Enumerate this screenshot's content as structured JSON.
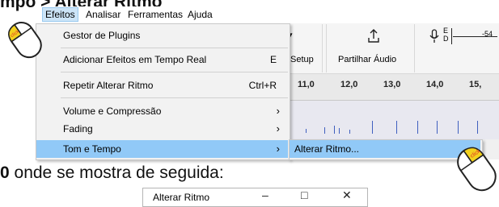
{
  "tutorial": {
    "heading": "mpo > Alterar Ritmo",
    "caption_bold": "0",
    "caption_text": " onde se mostra de seguida:"
  },
  "menubar": {
    "items": [
      "Efeitos",
      "Analisar",
      "Ferramentas",
      "Ajuda"
    ],
    "active_index": 0
  },
  "effects_menu": {
    "items": [
      {
        "label": "Gestor de Plugins",
        "shortcut": "",
        "submenu": false
      },
      {
        "label": "Adicionar Efeitos em Tempo Real",
        "shortcut": "E",
        "submenu": false
      },
      {
        "label": "Repetir Alterar Ritmo",
        "shortcut": "Ctrl+R",
        "submenu": false
      },
      {
        "label": "Volume e Compressão",
        "shortcut": "",
        "submenu": true
      },
      {
        "label": "Fading",
        "shortcut": "",
        "submenu": true
      },
      {
        "label": "Tom e Tempo",
        "shortcut": "",
        "submenu": true
      }
    ],
    "highlighted_index": 5
  },
  "submenu": {
    "items": [
      "Alterar Ritmo..."
    ],
    "highlighted_index": 0
  },
  "toolbar": {
    "setup_label": "Setup",
    "share_label": "Partilhar Áudio",
    "meter_top": "E",
    "meter_bottom": "D",
    "meter_value": "-54"
  },
  "ruler": {
    "ticks": [
      "11,0",
      "12,0",
      "13,0",
      "14,0",
      "15,"
    ]
  },
  "dialog": {
    "title": "Alterar Ritmo",
    "minimize": "–",
    "maximize": "□",
    "close": "✕"
  },
  "colors": {
    "menu_highlight": "#91c9f7",
    "mouse_button": "#f3d21e",
    "click_text": "#e0342a"
  },
  "icons": {
    "left_mouse": "mouse-left-click-icon",
    "right_mouse": "mouse-click-icon",
    "mic": "microphone-icon",
    "share": "share-upload-icon"
  },
  "mouse_label": "click"
}
